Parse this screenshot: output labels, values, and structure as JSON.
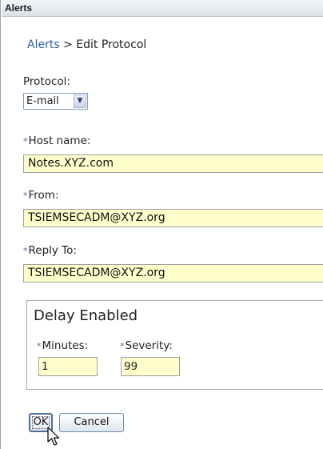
{
  "window": {
    "title": "Alerts"
  },
  "breadcrumb": {
    "parent": "Alerts",
    "separator": ">",
    "current": "Edit Protocol"
  },
  "form": {
    "protocol": {
      "label": "Protocol:",
      "value": "E-mail"
    },
    "host_name": {
      "required_mark": "*",
      "label": "Host name:",
      "value": "Notes.XYZ.com"
    },
    "from": {
      "required_mark": "*",
      "label": "From:",
      "value": "TSIEMSECADM@XYZ.org"
    },
    "reply_to": {
      "required_mark": "*",
      "label": "Reply To:",
      "value": "TSIEMSECADM@XYZ.org"
    },
    "delay": {
      "legend": "Delay Enabled",
      "minutes": {
        "required_mark": "*",
        "label": "Minutes:",
        "value": "1"
      },
      "severity": {
        "required_mark": "*",
        "label": "Severity:",
        "value": "99"
      }
    }
  },
  "buttons": {
    "ok": "OK",
    "cancel": "Cancel"
  },
  "colors": {
    "link": "#2a5ea8",
    "input_background": "#ffffcc",
    "required_mark": "#3a6ea5"
  },
  "icons": {
    "dropdown": "chevron-down-icon",
    "cursor": "mouse-pointer-icon"
  }
}
